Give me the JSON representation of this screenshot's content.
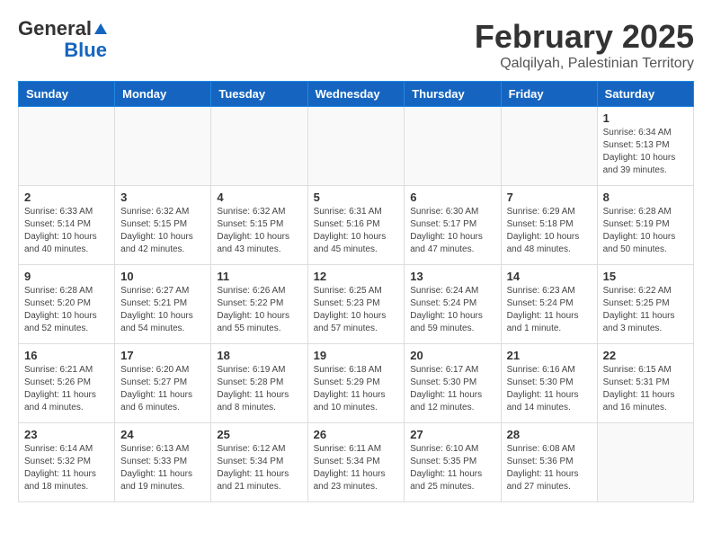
{
  "header": {
    "logo_line1": "General",
    "logo_line2": "Blue",
    "main_title": "February 2025",
    "subtitle": "Qalqilyah, Palestinian Territory"
  },
  "days_of_week": [
    "Sunday",
    "Monday",
    "Tuesday",
    "Wednesday",
    "Thursday",
    "Friday",
    "Saturday"
  ],
  "weeks": [
    [
      {
        "day": "",
        "detail": ""
      },
      {
        "day": "",
        "detail": ""
      },
      {
        "day": "",
        "detail": ""
      },
      {
        "day": "",
        "detail": ""
      },
      {
        "day": "",
        "detail": ""
      },
      {
        "day": "",
        "detail": ""
      },
      {
        "day": "1",
        "detail": "Sunrise: 6:34 AM\nSunset: 5:13 PM\nDaylight: 10 hours and 39 minutes."
      }
    ],
    [
      {
        "day": "2",
        "detail": "Sunrise: 6:33 AM\nSunset: 5:14 PM\nDaylight: 10 hours and 40 minutes."
      },
      {
        "day": "3",
        "detail": "Sunrise: 6:32 AM\nSunset: 5:15 PM\nDaylight: 10 hours and 42 minutes."
      },
      {
        "day": "4",
        "detail": "Sunrise: 6:32 AM\nSunset: 5:15 PM\nDaylight: 10 hours and 43 minutes."
      },
      {
        "day": "5",
        "detail": "Sunrise: 6:31 AM\nSunset: 5:16 PM\nDaylight: 10 hours and 45 minutes."
      },
      {
        "day": "6",
        "detail": "Sunrise: 6:30 AM\nSunset: 5:17 PM\nDaylight: 10 hours and 47 minutes."
      },
      {
        "day": "7",
        "detail": "Sunrise: 6:29 AM\nSunset: 5:18 PM\nDaylight: 10 hours and 48 minutes."
      },
      {
        "day": "8",
        "detail": "Sunrise: 6:28 AM\nSunset: 5:19 PM\nDaylight: 10 hours and 50 minutes."
      }
    ],
    [
      {
        "day": "9",
        "detail": "Sunrise: 6:28 AM\nSunset: 5:20 PM\nDaylight: 10 hours and 52 minutes."
      },
      {
        "day": "10",
        "detail": "Sunrise: 6:27 AM\nSunset: 5:21 PM\nDaylight: 10 hours and 54 minutes."
      },
      {
        "day": "11",
        "detail": "Sunrise: 6:26 AM\nSunset: 5:22 PM\nDaylight: 10 hours and 55 minutes."
      },
      {
        "day": "12",
        "detail": "Sunrise: 6:25 AM\nSunset: 5:23 PM\nDaylight: 10 hours and 57 minutes."
      },
      {
        "day": "13",
        "detail": "Sunrise: 6:24 AM\nSunset: 5:24 PM\nDaylight: 10 hours and 59 minutes."
      },
      {
        "day": "14",
        "detail": "Sunrise: 6:23 AM\nSunset: 5:24 PM\nDaylight: 11 hours and 1 minute."
      },
      {
        "day": "15",
        "detail": "Sunrise: 6:22 AM\nSunset: 5:25 PM\nDaylight: 11 hours and 3 minutes."
      }
    ],
    [
      {
        "day": "16",
        "detail": "Sunrise: 6:21 AM\nSunset: 5:26 PM\nDaylight: 11 hours and 4 minutes."
      },
      {
        "day": "17",
        "detail": "Sunrise: 6:20 AM\nSunset: 5:27 PM\nDaylight: 11 hours and 6 minutes."
      },
      {
        "day": "18",
        "detail": "Sunrise: 6:19 AM\nSunset: 5:28 PM\nDaylight: 11 hours and 8 minutes."
      },
      {
        "day": "19",
        "detail": "Sunrise: 6:18 AM\nSunset: 5:29 PM\nDaylight: 11 hours and 10 minutes."
      },
      {
        "day": "20",
        "detail": "Sunrise: 6:17 AM\nSunset: 5:30 PM\nDaylight: 11 hours and 12 minutes."
      },
      {
        "day": "21",
        "detail": "Sunrise: 6:16 AM\nSunset: 5:30 PM\nDaylight: 11 hours and 14 minutes."
      },
      {
        "day": "22",
        "detail": "Sunrise: 6:15 AM\nSunset: 5:31 PM\nDaylight: 11 hours and 16 minutes."
      }
    ],
    [
      {
        "day": "23",
        "detail": "Sunrise: 6:14 AM\nSunset: 5:32 PM\nDaylight: 11 hours and 18 minutes."
      },
      {
        "day": "24",
        "detail": "Sunrise: 6:13 AM\nSunset: 5:33 PM\nDaylight: 11 hours and 19 minutes."
      },
      {
        "day": "25",
        "detail": "Sunrise: 6:12 AM\nSunset: 5:34 PM\nDaylight: 11 hours and 21 minutes."
      },
      {
        "day": "26",
        "detail": "Sunrise: 6:11 AM\nSunset: 5:34 PM\nDaylight: 11 hours and 23 minutes."
      },
      {
        "day": "27",
        "detail": "Sunrise: 6:10 AM\nSunset: 5:35 PM\nDaylight: 11 hours and 25 minutes."
      },
      {
        "day": "28",
        "detail": "Sunrise: 6:08 AM\nSunset: 5:36 PM\nDaylight: 11 hours and 27 minutes."
      },
      {
        "day": "",
        "detail": ""
      }
    ]
  ]
}
